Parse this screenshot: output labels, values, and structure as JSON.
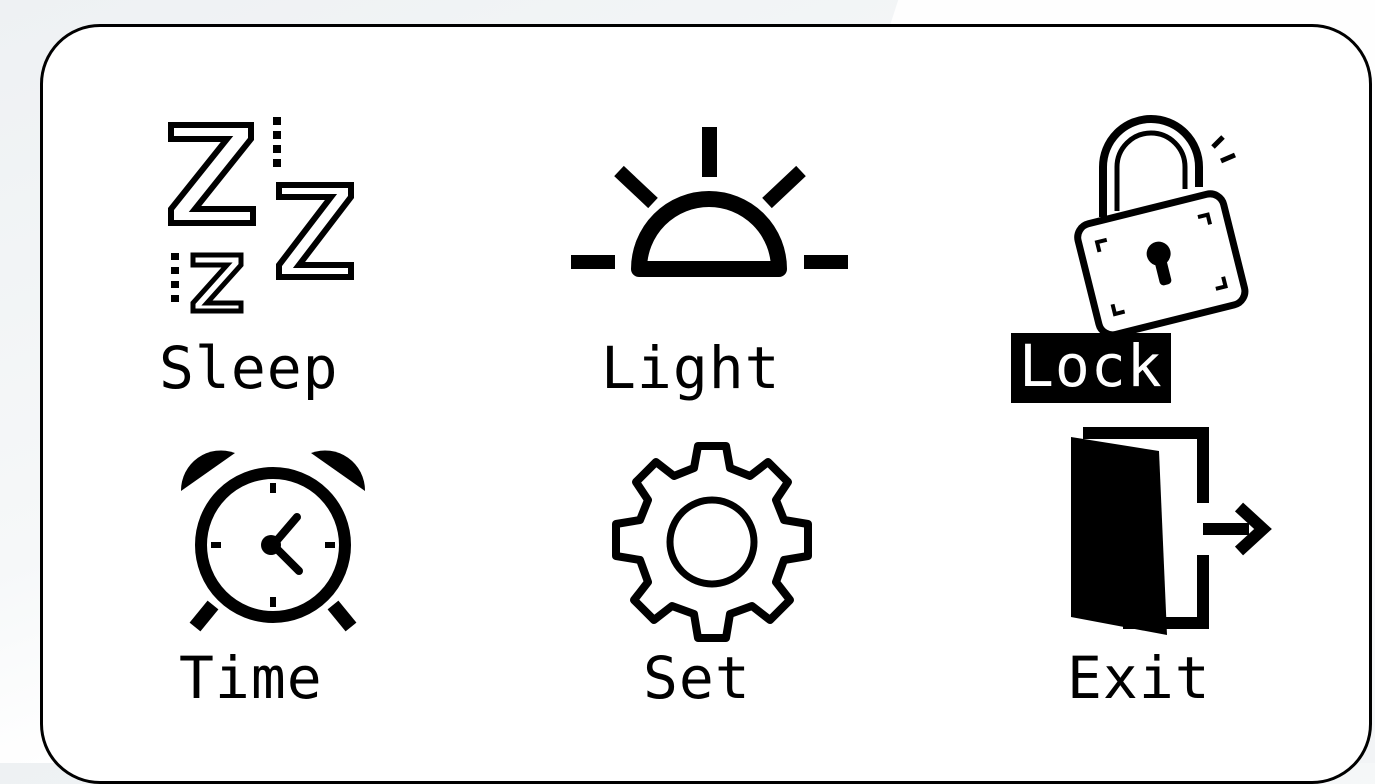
{
  "menu": {
    "items": [
      {
        "label": "Sleep",
        "icon": "sleep-zzz-icon",
        "selected": false
      },
      {
        "label": "Light",
        "icon": "sunrise-icon",
        "selected": false
      },
      {
        "label": "Lock",
        "icon": "padlock-open-icon",
        "selected": true
      },
      {
        "label": "Time",
        "icon": "alarm-clock-icon",
        "selected": false
      },
      {
        "label": "Set",
        "icon": "gear-icon",
        "selected": false
      },
      {
        "label": "Exit",
        "icon": "door-exit-icon",
        "selected": false
      }
    ]
  },
  "colors": {
    "foreground": "#000000",
    "background": "#ffffff",
    "selected_text": "#ffffff",
    "selected_bg": "#000000"
  }
}
